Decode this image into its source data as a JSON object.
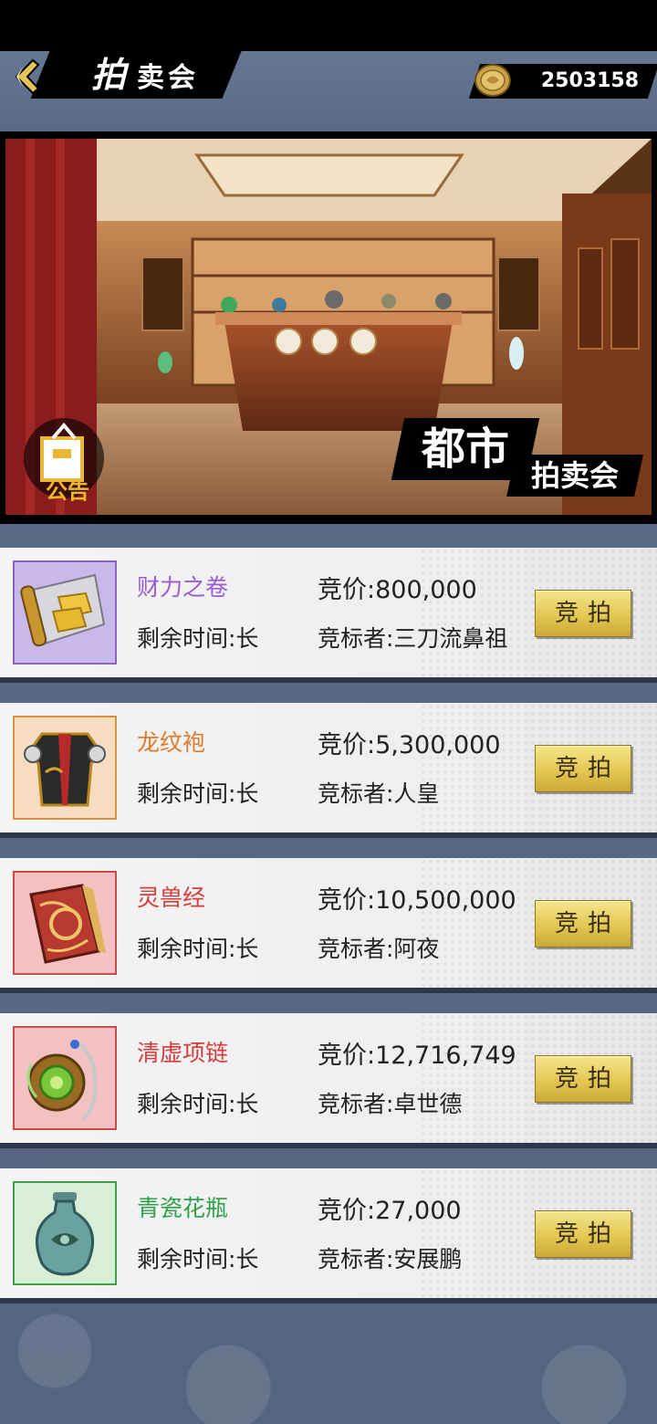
{
  "header": {
    "title_big": "拍",
    "title_rest": "卖会",
    "currency_value": "2503158",
    "back_icon": "chevron-left-icon",
    "coin_icon": "gold-coin-icon"
  },
  "banner": {
    "notice_label": "公告",
    "title_line1": "都市",
    "title_line2": "拍卖会"
  },
  "auctions": [
    {
      "name": "财力之卷",
      "name_color": "#9b5bd6",
      "frame_color": "#8a63c7",
      "time": "剩余时间:长",
      "price": "竞价:800,000",
      "bidder": "竞标者:三刀流鼻祖",
      "bid_label": "竞拍",
      "icon": "gold-scroll-icon"
    },
    {
      "name": "龙纹袍",
      "name_color": "#e07a2d",
      "frame_color": "#d98f45",
      "time": "剩余时间:长",
      "price": "竞价:5,300,000",
      "bidder": "竞标者:人皇",
      "bid_label": "竞拍",
      "icon": "dragon-robe-icon"
    },
    {
      "name": "灵兽经",
      "name_color": "#d63c3c",
      "frame_color": "#c94a4a",
      "time": "剩余时间:长",
      "price": "竞价:10,500,000",
      "bidder": "竞标者:阿夜",
      "bid_label": "竞拍",
      "icon": "beast-scripture-book-icon"
    },
    {
      "name": "清虚项链",
      "name_color": "#d63c3c",
      "frame_color": "#c94a4a",
      "time": "剩余时间:长",
      "price": "竞价:12,716,749",
      "bidder": "竞标者:卓世德",
      "bid_label": "竞拍",
      "icon": "jade-necklace-icon"
    },
    {
      "name": "青瓷花瓶",
      "name_color": "#2ea24a",
      "frame_color": "#3aa24e",
      "time": "剩余时间:长",
      "price": "竞价:27,000",
      "bidder": "竞标者:安展鹏",
      "bid_label": "竞拍",
      "icon": "celadon-vase-icon"
    }
  ]
}
